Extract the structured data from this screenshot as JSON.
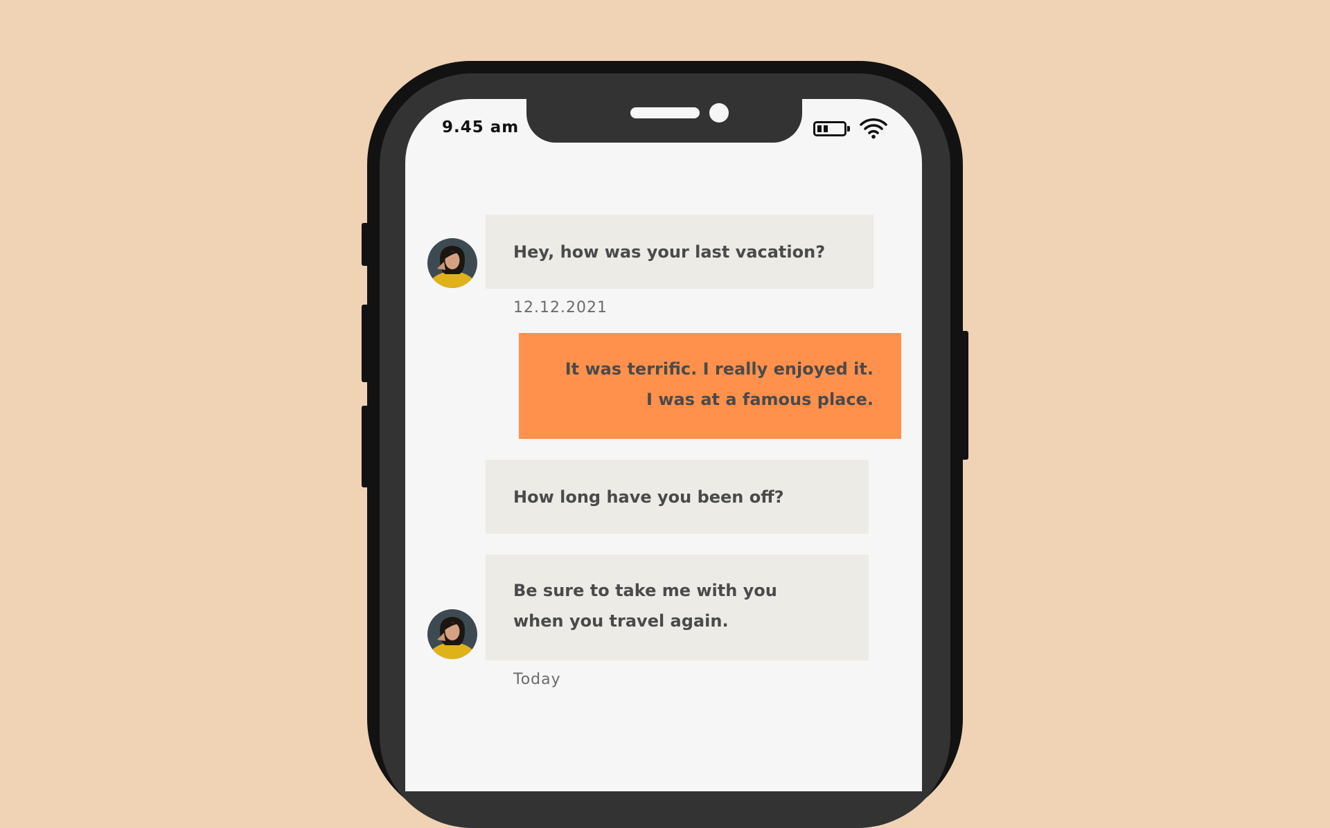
{
  "colors": {
    "background": "#F0D2B5",
    "phone_frame": "#121212",
    "phone_bezel": "#333333",
    "screen": "#F6F6F6",
    "incoming_bubble": "#ECEBE6",
    "outgoing_bubble": "#FF914D",
    "message_text": "#4A4A4A",
    "avatar_shirt": "#E0B21A"
  },
  "status_bar": {
    "time": "9.45 am",
    "battery_icon": "battery-low-icon",
    "wifi_icon": "wifi-icon"
  },
  "messages": [
    {
      "direction": "incoming",
      "lines": [
        "Hey, how was your last vacation?"
      ],
      "avatar": "contact-avatar",
      "timestamp": "12.12.2021"
    },
    {
      "direction": "outgoing",
      "lines": [
        "It was terrific. I really enjoyed it.",
        "I was at a famous place."
      ]
    },
    {
      "direction": "incoming",
      "lines": [
        "How long have you been off?"
      ]
    },
    {
      "direction": "incoming",
      "lines": [
        "Be sure to take me with you",
        "when you travel again."
      ],
      "avatar": "contact-avatar",
      "timestamp": "Today"
    }
  ]
}
